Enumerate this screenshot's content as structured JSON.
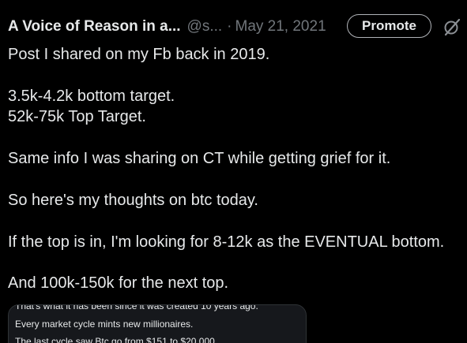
{
  "header": {
    "author_name": "A Voice of Reason in a...",
    "handle": "@s...",
    "separator": "·",
    "date": "May 21, 2021",
    "promote_label": "Promote",
    "grok_icon": "grok-slash-icon"
  },
  "tweet": {
    "lines": [
      "Post I shared on my Fb back in 2019.",
      "",
      "3.5k-4.2k bottom target.",
      "52k-75k Top Target.",
      "",
      "Same info I was sharing on CT while getting grief for it.",
      "",
      "So here's my thoughts on btc today.",
      "",
      "If the top is in, I'm looking for 8-12k as the EVENTUAL bottom.",
      "",
      "And 100k-150k for the next top."
    ]
  },
  "embed": {
    "lines": [
      "That's what it has been since it was created 10 years ago.",
      "Every market cycle mints new millionaires.",
      "The last cycle saw Btc go from $151 to $20,000"
    ]
  }
}
